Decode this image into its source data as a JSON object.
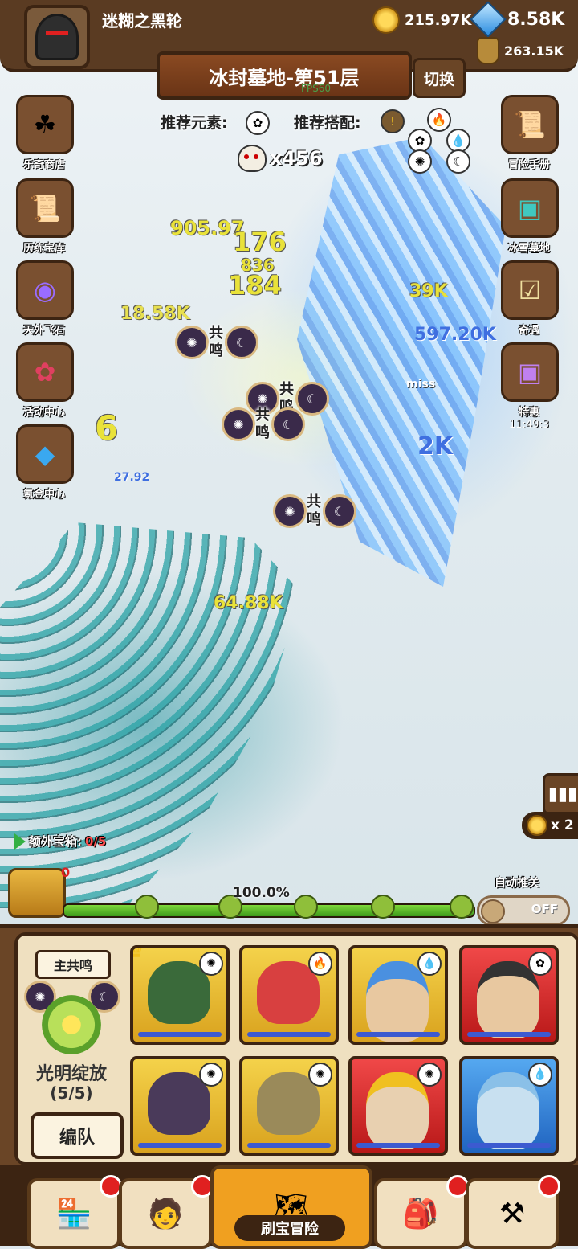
{
  "player": {
    "name": "迷糊之黑轮"
  },
  "resources": {
    "gold": "215.97K",
    "gems": "8.58K",
    "potion": "263.15K"
  },
  "stage": {
    "title": "冰封墓地-第51层",
    "fps": "FPS60",
    "switch_label": "切换"
  },
  "recommend": {
    "element_label": "推荐元素:",
    "combo_label": "推荐搭配:"
  },
  "kills": "x456",
  "left_menu": [
    {
      "label": "乐奇商店",
      "icon": "clover-icon"
    },
    {
      "label": "历练宝库",
      "icon": "scroll-vault-icon"
    },
    {
      "label": "天外飞石",
      "icon": "portal-icon"
    },
    {
      "label": "活动中心",
      "icon": "bouquet-icon"
    },
    {
      "label": "氪金中心",
      "icon": "diamond-icon"
    }
  ],
  "right_menu": [
    {
      "label": "冒险手册",
      "icon": "scroll-icon"
    },
    {
      "label": "冰雪墓地",
      "icon": "treasure-chest-icon"
    },
    {
      "label": "奇遇",
      "icon": "quest-board-icon"
    },
    {
      "label": "特惠",
      "icon": "gift-chest-icon",
      "timer": "11:49:3"
    }
  ],
  "damage_numbers": [
    "905.97",
    "176",
    "184",
    "836",
    "18.58K",
    "64.88K",
    "39K",
    "597.20K",
    "2K",
    "27.92",
    "6",
    "miss"
  ],
  "resonance_marker": "共鸣",
  "speed": "x 2",
  "progress": {
    "extra_chest_label": "额外宝箱:",
    "extra_chest_count": "0/5",
    "chest_badge": "0",
    "percent_text": "100.0%",
    "fill": 1.0
  },
  "auto": {
    "label": "自动推关",
    "state": "OFF"
  },
  "team": {
    "main_label": "主共鸣",
    "skill_name": "光明绽放",
    "skill_count": "(5/5)",
    "formation_label": "编队",
    "heroes": [
      {
        "name": "hooded-green-hero",
        "frame": "gold",
        "element": "light",
        "crown": true
      },
      {
        "name": "red-demon-hero",
        "frame": "gold",
        "element": "fire",
        "crown": false
      },
      {
        "name": "blue-hair-hero",
        "frame": "gold",
        "element": "water",
        "crown": false
      },
      {
        "name": "scarred-hero",
        "frame": "red",
        "element": "wind",
        "crown": false
      },
      {
        "name": "purple-hood-hero",
        "frame": "gold",
        "element": "light",
        "crown": false
      },
      {
        "name": "spartan-hero",
        "frame": "gold",
        "element": "light",
        "crown": false
      },
      {
        "name": "king-hero",
        "frame": "red",
        "element": "light",
        "crown": false
      },
      {
        "name": "ice-crown-hero",
        "frame": "gold",
        "element": "water",
        "crown": false
      }
    ]
  },
  "bottom_nav": [
    {
      "name": "shop",
      "icon": "shop-icon",
      "badge": true
    },
    {
      "name": "heroes",
      "icon": "hero-portrait-icon",
      "badge": true
    },
    {
      "name": "adventure",
      "icon": "treasure-map-icon",
      "badge": false,
      "label": "刷宝冒险"
    },
    {
      "name": "backpack",
      "icon": "backpack-icon",
      "badge": true
    },
    {
      "name": "forge",
      "icon": "hammer-icon",
      "badge": true
    }
  ],
  "colors": {
    "wood": "#5a3b22",
    "wood_dark": "#3c2412",
    "panel": "#efe0c0",
    "accent": "#f0a020"
  }
}
